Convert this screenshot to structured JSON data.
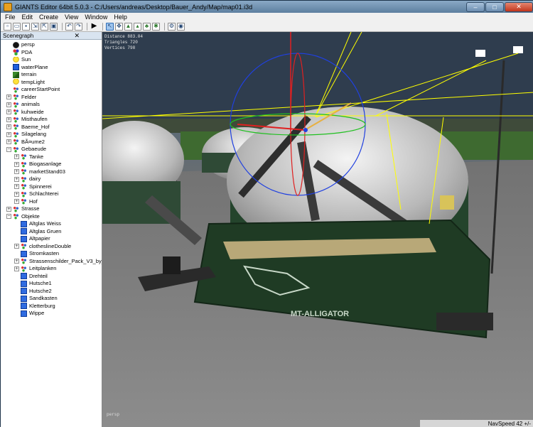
{
  "window": {
    "title": "GIANTS Editor 64bit 5.0.3 - C:/Users/andreas/Desktop/Bauer_Andy/Map/map01.i3d",
    "minimize_glyph": "–",
    "maximize_glyph": "□",
    "close_glyph": "✕"
  },
  "menu": [
    "File",
    "Edit",
    "Create",
    "View",
    "Window",
    "Help"
  ],
  "toolbar": {
    "buttons": [
      "new-file-icon",
      "open-file-icon",
      "save-icon",
      "import-icon",
      "export-icon",
      "save-as-icon",
      "separator",
      "undo-icon",
      "redo-icon",
      "separator",
      "play-icon",
      "separator",
      "select-tool-icon",
      "move-tool-icon",
      "terrain-sculpt-icon",
      "terrain-paint-icon",
      "foliage-paint-icon",
      "grass-paint-icon",
      "separator",
      "settings-icon",
      "camera-settings-icon"
    ],
    "play_glyph": "▶"
  },
  "scenegraph": {
    "title": "Scenegraph",
    "close_glyph": "✕",
    "nodes": [
      {
        "label": "persp",
        "icon": "camera-icon",
        "depth": 1,
        "expander": ""
      },
      {
        "label": "PDA",
        "icon": "group-icon",
        "depth": 1,
        "expander": ""
      },
      {
        "label": "Sun",
        "icon": "light-icon",
        "depth": 1,
        "expander": ""
      },
      {
        "label": "waterPlane",
        "icon": "water-icon",
        "depth": 1,
        "expander": ""
      },
      {
        "label": "terrain",
        "icon": "terrain-icon",
        "depth": 1,
        "expander": ""
      },
      {
        "label": "tempLight",
        "icon": "light-icon",
        "depth": 1,
        "expander": ""
      },
      {
        "label": "careerStartPoint",
        "icon": "transform-group-icon",
        "depth": 1,
        "expander": ""
      },
      {
        "label": "Felder",
        "icon": "transform-group-icon",
        "depth": 1,
        "expander": "+"
      },
      {
        "label": "animals",
        "icon": "transform-group-icon",
        "depth": 1,
        "expander": "+"
      },
      {
        "label": "kuhweide",
        "icon": "transform-group-icon",
        "depth": 1,
        "expander": "+"
      },
      {
        "label": "Misthaufen",
        "icon": "transform-group-icon",
        "depth": 1,
        "expander": "+"
      },
      {
        "label": "Baeme_Hof",
        "icon": "transform-group-icon",
        "depth": 1,
        "expander": "+"
      },
      {
        "label": "Silagelang",
        "icon": "transform-group-icon",
        "depth": 1,
        "expander": "+"
      },
      {
        "label": "BÃ¤ume2",
        "icon": "transform-group-icon",
        "depth": 1,
        "expander": "+"
      },
      {
        "label": "Gebaeude",
        "icon": "transform-group-icon",
        "depth": 1,
        "expander": "−"
      },
      {
        "label": "Tanke",
        "icon": "transform-group-icon",
        "depth": 2,
        "expander": "+"
      },
      {
        "label": "Biogasanlage",
        "icon": "transform-group-icon",
        "depth": 2,
        "expander": "+"
      },
      {
        "label": "marketStand03",
        "icon": "transform-group-icon",
        "depth": 2,
        "expander": "+"
      },
      {
        "label": "dairy",
        "icon": "transform-group-icon",
        "depth": 2,
        "expander": "+"
      },
      {
        "label": "Spinnerei",
        "icon": "transform-group-icon",
        "depth": 2,
        "expander": "+"
      },
      {
        "label": "Schlachterei",
        "icon": "transform-group-icon",
        "depth": 2,
        "expander": "+"
      },
      {
        "label": "Hof",
        "icon": "transform-group-icon",
        "depth": 2,
        "expander": "+"
      },
      {
        "label": "Strasse",
        "icon": "transform-group-icon",
        "depth": 1,
        "expander": "+"
      },
      {
        "label": "Objekte",
        "icon": "transform-group-icon",
        "depth": 1,
        "expander": "−"
      },
      {
        "label": "Altglas Weiss",
        "icon": "mesh-icon",
        "depth": 2,
        "expander": ""
      },
      {
        "label": "Altglas Gruen",
        "icon": "mesh-icon",
        "depth": 2,
        "expander": ""
      },
      {
        "label": "Altpapier",
        "icon": "mesh-icon",
        "depth": 2,
        "expander": ""
      },
      {
        "label": "clotheslineDouble",
        "icon": "transform-group-icon",
        "depth": 2,
        "expander": "+"
      },
      {
        "label": "Stromkasten",
        "icon": "mesh-icon",
        "depth": 2,
        "expander": ""
      },
      {
        "label": "Strassenschilder_Pack_V3_by_N",
        "icon": "transform-group-icon",
        "depth": 2,
        "expander": "+"
      },
      {
        "label": "Leitplanken",
        "icon": "transform-group-icon",
        "depth": 2,
        "expander": "+"
      },
      {
        "label": "Drehteil",
        "icon": "mesh-icon",
        "depth": 2,
        "expander": ""
      },
      {
        "label": "Hutsche1",
        "icon": "mesh-icon",
        "depth": 2,
        "expander": ""
      },
      {
        "label": "Hutsche2",
        "icon": "mesh-icon",
        "depth": 2,
        "expander": ""
      },
      {
        "label": "Sandkasten",
        "icon": "mesh-icon",
        "depth": 2,
        "expander": ""
      },
      {
        "label": "Kletterburg",
        "icon": "mesh-icon",
        "depth": 2,
        "expander": ""
      },
      {
        "label": "Wippe",
        "icon": "mesh-icon",
        "depth": 2,
        "expander": ""
      }
    ]
  },
  "viewport": {
    "stats": [
      "Distance 883.04",
      "Triangles 720",
      "Vertices 798"
    ],
    "camera_label": "persp",
    "status": "NavSpeed 42 +/-",
    "trailer_brand": "MT-ALLIGATOR"
  },
  "colors": {
    "title_bar": "#5d7f9f",
    "trailer_green": "#1f3b24",
    "selection_yellow": "#ffff00",
    "gizmo_red": "#e02020",
    "gizmo_blue": "#2040e0",
    "gizmo_green": "#20c020"
  }
}
